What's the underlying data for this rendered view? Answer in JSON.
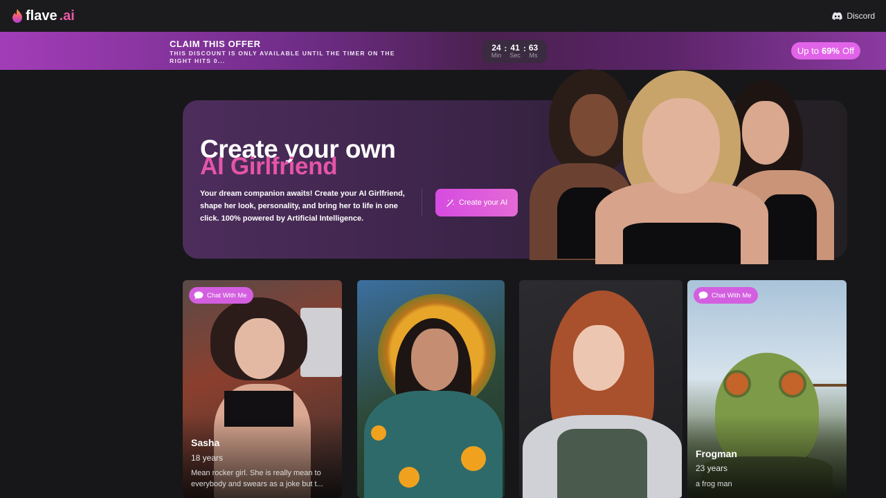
{
  "nav": {
    "brand_main": "flave",
    "brand_accent": ".ai",
    "discord_label": "Discord"
  },
  "offer": {
    "title": "CLAIM THIS OFFER",
    "subtitle": "THIS DISCOUNT IS ONLY AVAILABLE UNTIL THE TIMER ON THE RIGHT HITS 0...",
    "timer": [
      {
        "value": "24",
        "label": "Min"
      },
      {
        "value": "41",
        "label": "Sec"
      },
      {
        "value": "63",
        "label": "Ms"
      }
    ],
    "discount_prefix": "Up to",
    "discount_value": "69%",
    "discount_suffix": "Off"
  },
  "hero": {
    "title_line1": "Create your own",
    "title_line2": "AI Girlfriend",
    "description": "Your dream companion awaits! Create your AI Girlfriend, shape her look, personality, and bring her to life in one click. 100% powered by Artificial Intelligence.",
    "cta_label": "Create your AI"
  },
  "cards": [
    {
      "chip": "Chat With Me",
      "name": "Sasha",
      "age": "18 years",
      "desc": "Mean rocker girl. She is really mean to everybody and swears as a joke but t..."
    },
    {
      "chip": "",
      "name": "",
      "age": "",
      "desc": ""
    },
    {
      "chip": "",
      "name": "",
      "age": "",
      "desc": ""
    },
    {
      "chip": "Chat With Me",
      "name": "Frogman",
      "age": "23 years",
      "desc": "a frog man"
    }
  ],
  "colors": {
    "accent_pink": "#e455a6",
    "chip_purple": "#d35fe0",
    "background": "#171719"
  }
}
